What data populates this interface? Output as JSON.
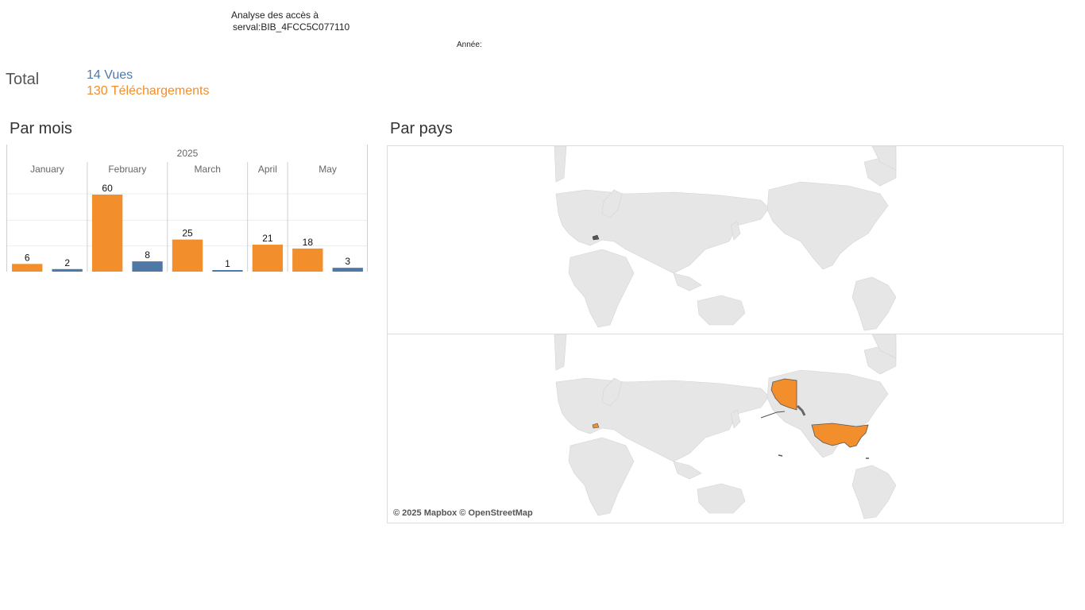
{
  "header": {
    "title_line1": "Analyse des accès à",
    "title_line2": "serval:BIB_4FCC5C077110",
    "year_filter_label": "Année:"
  },
  "totals": {
    "label": "Total",
    "views_text": "14 Vues",
    "downloads_text": "130 Téléchargements",
    "views_color": "#4e79a7",
    "downloads_color": "#f28e2b"
  },
  "by_month": {
    "heading": "Par mois"
  },
  "by_country": {
    "heading": "Par pays",
    "attribution": "© 2025 Mapbox © OpenStreetMap",
    "highlight_color": "#f28e2b",
    "land_color": "#e6e6e6"
  },
  "chart_data": {
    "type": "bar",
    "year": "2025",
    "categories": [
      "January",
      "February",
      "March",
      "April",
      "May"
    ],
    "series": [
      {
        "key": "downloads",
        "color": "#f28e2b",
        "values": [
          6,
          60,
          25,
          21,
          18
        ]
      },
      {
        "key": "views",
        "color": "#4e79a7",
        "values": [
          2,
          8,
          1,
          null,
          3
        ]
      }
    ],
    "ylim": [
      0,
      60
    ],
    "grid": true
  }
}
